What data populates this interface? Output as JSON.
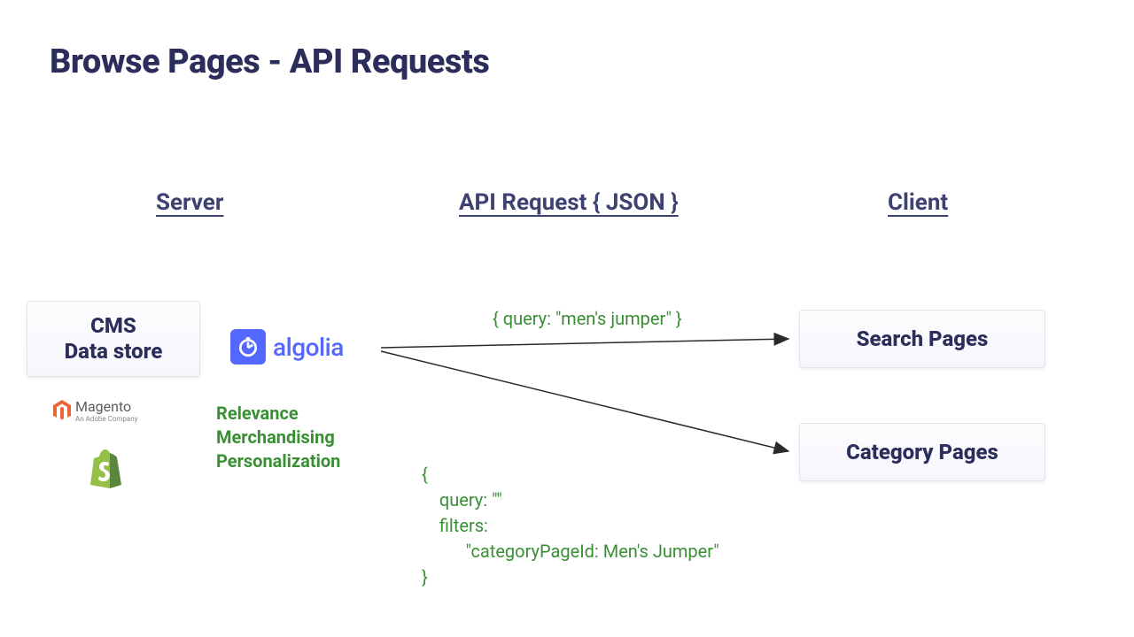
{
  "title": "Browse Pages - API Requests",
  "columns": {
    "server": "Server",
    "api": "API Request { JSON }",
    "client": "Client"
  },
  "cms": {
    "line1": "CMS",
    "line2": "Data store"
  },
  "algolia": {
    "name": "algolia"
  },
  "features": {
    "f1": "Relevance",
    "f2": "Merchandising",
    "f3": "Personalization"
  },
  "json": {
    "top": "{ query: \"men's jumper\" }",
    "bottom": "{\n    query: \"\"\n    filters:\n          \"categoryPageId: Men's Jumper\"\n}"
  },
  "client_cards": {
    "search": "Search Pages",
    "category": "Category Pages"
  },
  "logos": {
    "magento": "Magento",
    "magento_sub": "An Adobe Company"
  }
}
